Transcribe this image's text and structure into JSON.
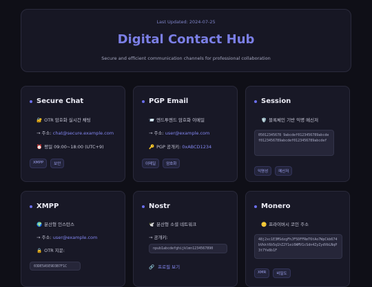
{
  "header": {
    "last_updated": "Last Updated: 2024-07-25",
    "title": "Digital Contact Hub",
    "subtitle": "Secure and efficient communication channels for professional collaboration"
  },
  "cards": {
    "secure_chat": {
      "title": "Secure Chat",
      "desc": "OTR 암호화 실시간 채팅",
      "addr_label": "→ 주소:",
      "addr": "chat@secure.example.com",
      "hours": "평일 09:00~18:00 (UTC+9)",
      "tags": [
        "XMPP",
        "보안"
      ]
    },
    "pgp_email": {
      "title": "PGP Email",
      "desc": "엔드투엔드 암호화 이메일",
      "addr_label": "→ 주소:",
      "addr": "user@example.com",
      "key_label": "PGP 공개키:",
      "key": "0xABCD1234",
      "tags": [
        "이메일",
        "암호화"
      ]
    },
    "session": {
      "title": "Session",
      "desc": "블록체인 기반 익명 메신저",
      "id": "05012345678 9abcdef0123456789abcdef0123456789abcdef0123456789abcdef",
      "tags": [
        "익명성",
        "메신저"
      ]
    },
    "xmpp": {
      "title": "XMPP",
      "desc": "분산형 인스턴스",
      "addr_label": "→ 주소:",
      "addr": "user@example.com",
      "otr_label": "OTR 지문:",
      "otr": "03DE5A5E9D3B7F1C"
    },
    "nostr": {
      "title": "Nostr",
      "desc": "분산형 소셜 네트워크",
      "key_label": "→ 공개키:",
      "key": "npub1abcdefghijklmn1234567890",
      "profile": "프로필 보기"
    },
    "monero": {
      "title": "Monero",
      "desc": "프라이버시 코인 주소",
      "address": "48j2xc1E3MSdzgFhJF5DFFRmT6tAo7WpCkb674bVkkt6b5q1hZ2Y1ei6WMV1cSdn4ZyZydVbLNqP3t7Ye8b1F",
      "tags": [
        "XMR",
        "비밀도"
      ]
    }
  }
}
